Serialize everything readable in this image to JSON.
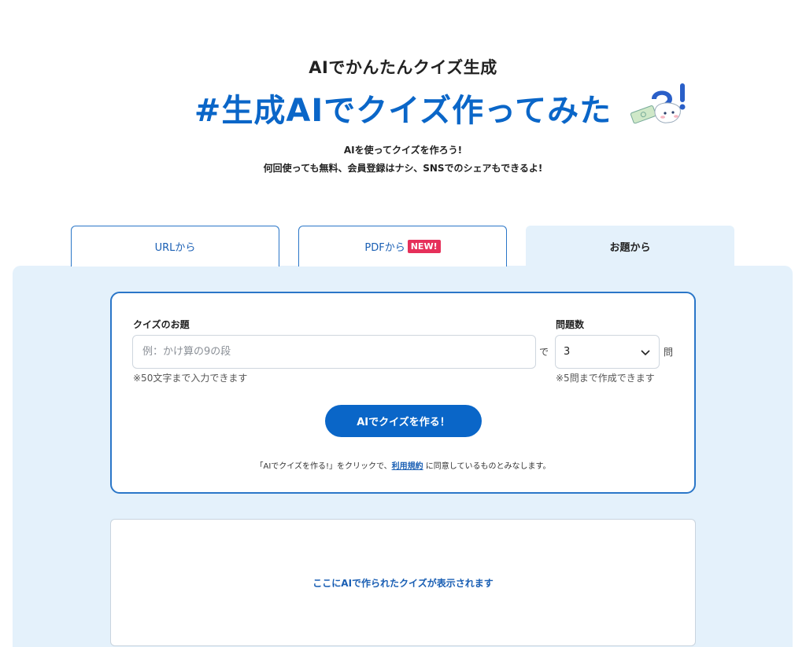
{
  "hero": {
    "subtitle": "AIでかんたんクイズ生成",
    "title": "#生成AIでクイズ作ってみた",
    "desc_line1": "AIを使ってクイズを作ろう!",
    "desc_line2": "何回使っても無料、会員登録はナシ、SNSでのシェアもできるよ!",
    "mascot_icon": "question-mascot-icon"
  },
  "tabs": [
    {
      "label": "URLから"
    },
    {
      "label": "PDFから",
      "badge": "NEW!"
    },
    {
      "label": "お題から",
      "active": true
    }
  ],
  "form": {
    "topic_label": "クイズのお題",
    "topic_placeholder": "例：かけ算の9の段",
    "topic_value": "",
    "topic_hint": "※50文字まで入力できます",
    "de_label": "で",
    "count_label": "問題数",
    "count_value": "3",
    "count_unit": "問",
    "count_hint": "※5問まで作成できます",
    "submit_label": "AIでクイズを作る！",
    "terms_prefix": "「AIでクイズを作る!」をクリックで、",
    "terms_link": "利用規約",
    "terms_suffix": " に同意しているものとみなします。"
  },
  "result": {
    "placeholder": "ここにAIで作られたクイズが表示されます"
  },
  "colors": {
    "accent": "#0a66c8",
    "panel_bg": "#e4f1fb",
    "badge": "#e6305a"
  }
}
